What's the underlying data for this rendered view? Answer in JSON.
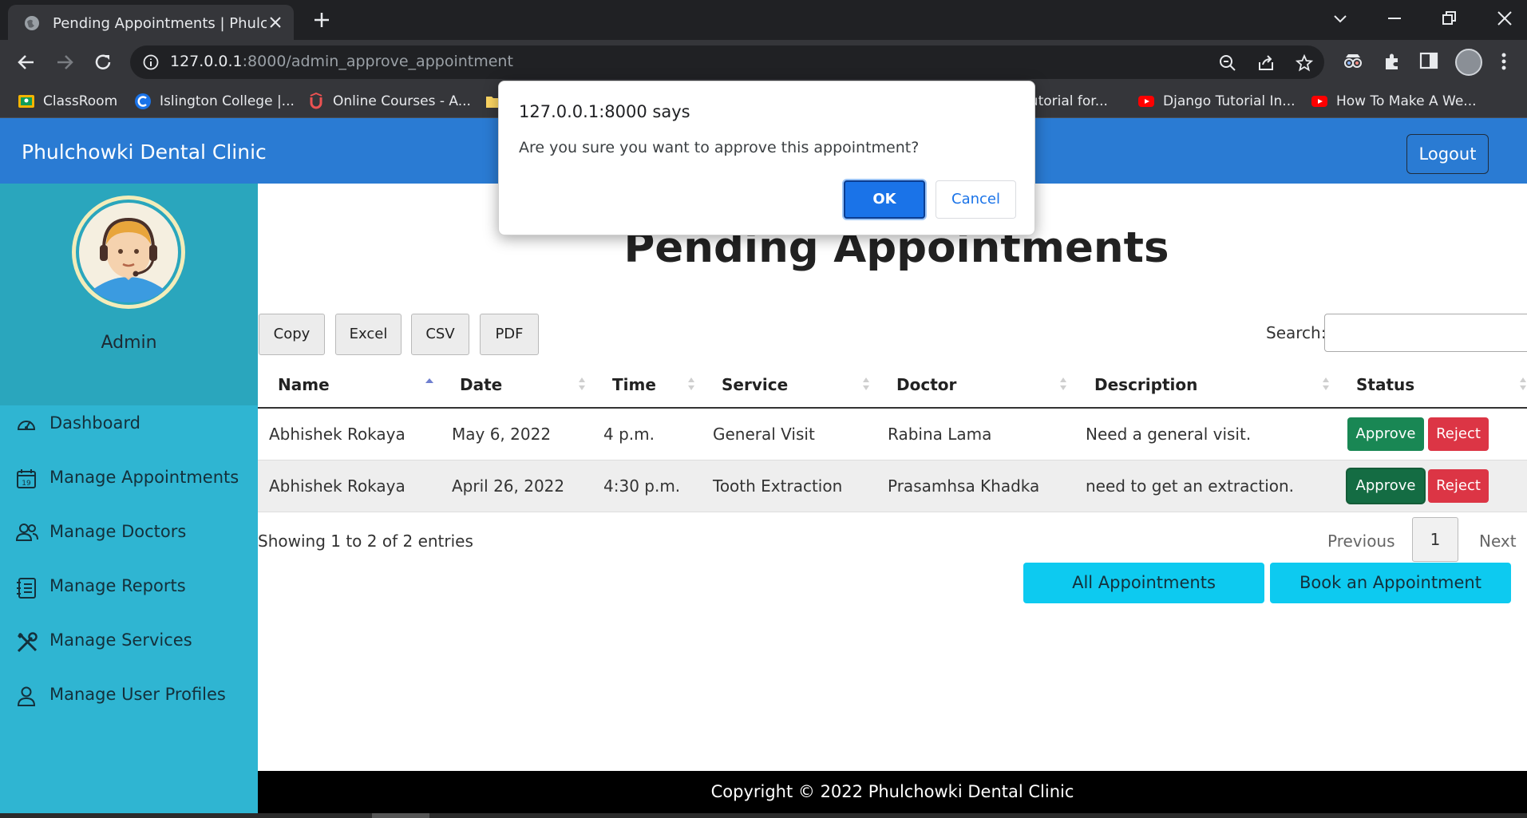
{
  "browser": {
    "tab_title": "Pending Appointments | Phulchowki Dental Clinic",
    "url_host": "127.0.0.1",
    "url_rest": ":8000/admin_approve_appointment",
    "bookmarks": [
      {
        "label": "ClassRoom",
        "icon": "classroom-icon",
        "color": "#f4b400"
      },
      {
        "label": "Islington College |...",
        "icon": "islington-icon",
        "color": "#1a73e8"
      },
      {
        "label": "Online Courses - A...",
        "icon": "udemy-icon",
        "color": "#ec5252"
      },
      {
        "label": "Tutorial for...",
        "icon": "youtube-icon",
        "color": "#ff0000"
      },
      {
        "label": "Django Tutorial In...",
        "icon": "youtube-icon",
        "color": "#ff0000"
      },
      {
        "label": "How To Make A We...",
        "icon": "youtube-icon",
        "color": "#ff0000"
      }
    ]
  },
  "header": {
    "brand": "Phulchowki Dental Clinic",
    "logout": "Logout",
    "color": "#2a7bd3"
  },
  "sidebar": {
    "user": "Admin",
    "items": [
      {
        "label": "Dashboard",
        "icon": "dashboard-icon"
      },
      {
        "label": "Manage Appointments",
        "icon": "calendar-icon"
      },
      {
        "label": "Manage Doctors",
        "icon": "users-icon"
      },
      {
        "label": "Manage Reports",
        "icon": "report-icon"
      },
      {
        "label": "Manage Services",
        "icon": "tools-icon"
      },
      {
        "label": "Manage User Profiles",
        "icon": "user-icon"
      }
    ]
  },
  "main": {
    "title": "Pending Appointments",
    "export_buttons": [
      "Copy",
      "Excel",
      "CSV",
      "PDF"
    ],
    "search_label": "Search:",
    "columns": [
      "Name",
      "Date",
      "Time",
      "Service",
      "Doctor",
      "Description",
      "Status"
    ],
    "rows": [
      {
        "name": "Abhishek Rokaya",
        "date": "May 6, 2022",
        "time": "4 p.m.",
        "service": "General Visit",
        "doctor": "Rabina Lama",
        "description": "Need a general visit.",
        "approve": "Approve",
        "reject": "Reject"
      },
      {
        "name": "Abhishek Rokaya",
        "date": "April 26, 2022",
        "time": "4:30 p.m.",
        "service": "Tooth Extraction",
        "doctor": "Prasamhsa Khadka",
        "description": "need to get an extraction.",
        "approve": "Approve",
        "reject": "Reject"
      }
    ],
    "info": "Showing 1 to 2 of 2 entries",
    "pager": {
      "previous": "Previous",
      "current": "1",
      "next": "Next"
    },
    "all_appointments": "All Appointments",
    "book_appointment": "Book an Appointment"
  },
  "footer": {
    "text": "Copyright © 2022 Phulchowki Dental Clinic"
  },
  "dialog": {
    "title": "127.0.0.1:8000 says",
    "message": "Are you sure you want to approve this appointment?",
    "ok": "OK",
    "cancel": "Cancel"
  }
}
